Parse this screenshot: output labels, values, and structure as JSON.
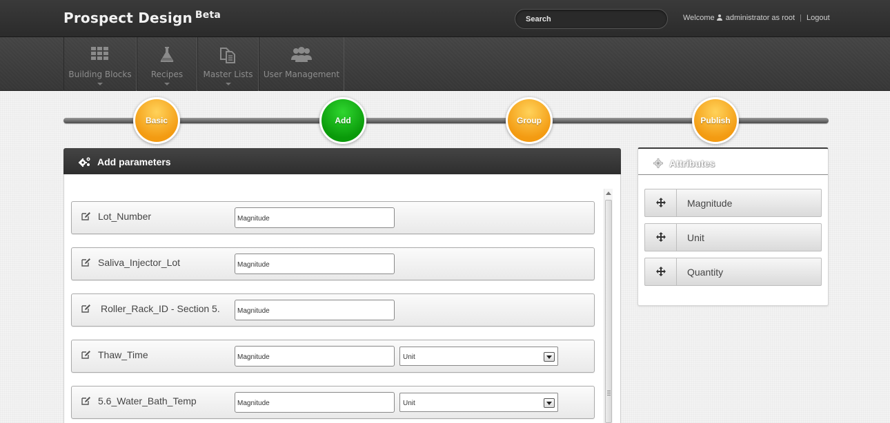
{
  "header": {
    "brand": "Prospect Design",
    "brand_badge": "Beta",
    "search_placeholder": "Search",
    "welcome_prefix": "Welcome",
    "user_text": "administrator as root",
    "separator": "|",
    "logout": "Logout"
  },
  "nav": {
    "items": [
      {
        "label": "Building Blocks",
        "icon": "grid-icon",
        "has_caret": true
      },
      {
        "label": "Recipes",
        "icon": "flask-icon",
        "has_caret": true
      },
      {
        "label": "Master Lists",
        "icon": "documents-icon",
        "has_caret": true
      },
      {
        "label": "User Management",
        "icon": "users-icon",
        "has_caret": false
      }
    ]
  },
  "steps": [
    {
      "label": "Basic",
      "state": "inactive",
      "color": "#f5a623"
    },
    {
      "label": "Add",
      "state": "active",
      "color": "#0fb00f"
    },
    {
      "label": "Group",
      "state": "inactive",
      "color": "#f5a623"
    },
    {
      "label": "Publish",
      "state": "inactive",
      "color": "#f5a623"
    }
  ],
  "parameters_panel": {
    "title": "Add parameters",
    "rows": [
      {
        "name": "Lot_Number",
        "magnitude_placeholder": "Magnitude",
        "unit": null
      },
      {
        "name": "Saliva_Injector_Lot",
        "magnitude_placeholder": "Magnitude",
        "unit": null
      },
      {
        "name": "Roller_Rack_ID - Section 5.",
        "magnitude_placeholder": "Magnitude",
        "unit": null
      },
      {
        "name": "Thaw_Time",
        "magnitude_placeholder": "Magnitude",
        "unit": "Unit"
      },
      {
        "name": "5.6_Water_Bath_Temp",
        "magnitude_placeholder": "Magnitude",
        "unit": "Unit"
      }
    ]
  },
  "attributes_panel": {
    "title": "Attributes",
    "items": [
      {
        "label": "Magnitude"
      },
      {
        "label": "Unit"
      },
      {
        "label": "Quantity"
      }
    ]
  }
}
